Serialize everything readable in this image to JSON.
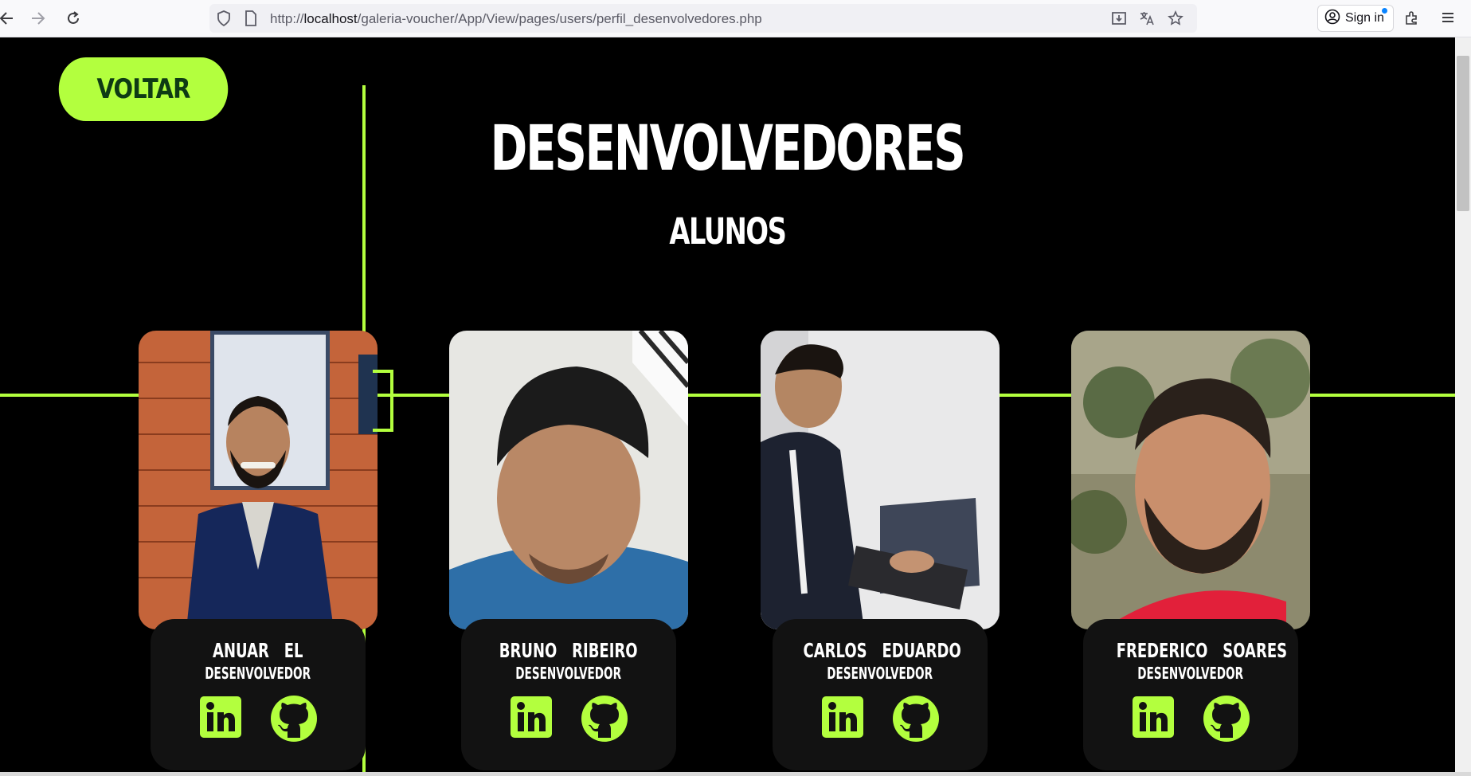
{
  "browser": {
    "url_prefix": "http://",
    "url_host": "localhost",
    "url_path": "/galeria-voucher/App/View/pages/users/perfil_desenvolvedores.php",
    "signin_label": "Sign in",
    "icons": [
      "back-icon",
      "forward-icon",
      "reload-icon",
      "shield-icon",
      "page-icon",
      "download-icon",
      "translate-icon",
      "star-icon",
      "account-icon",
      "extensions-icon",
      "menu-icon"
    ]
  },
  "page": {
    "back_button": "VOLTAR",
    "title": "DESENVOLVEDORES",
    "subtitle": "ALUNOS",
    "accent_color": "#b3ff3e",
    "developers": [
      {
        "name": "ANUAR   EL",
        "role": "DESENVOLVEDOR"
      },
      {
        "name": "BRUNO   RIBEIRO",
        "role": "DESENVOLVEDOR"
      },
      {
        "name": "CARLOS   EDUARDO",
        "role": "DESENVOLVEDOR"
      },
      {
        "name": "FREDERICO   SOARES",
        "role": "DESENVOLVEDOR"
      }
    ]
  }
}
